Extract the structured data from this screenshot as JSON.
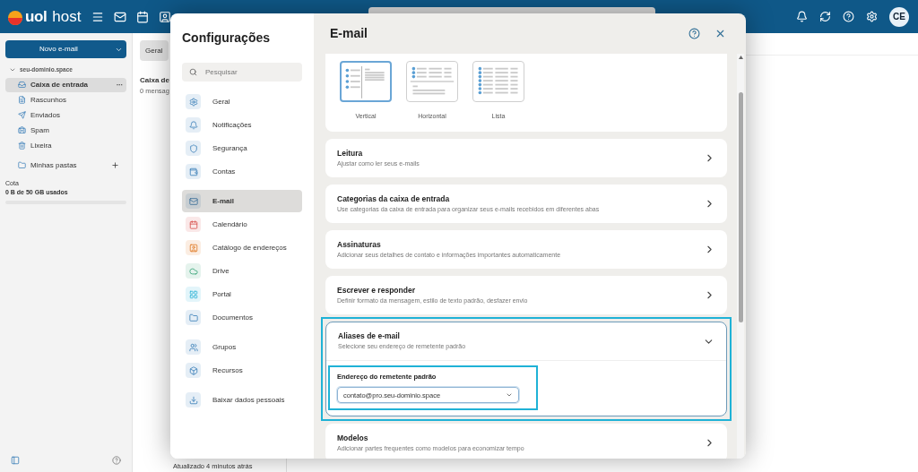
{
  "header": {
    "brand": "uol",
    "product": "host",
    "avatar": "CE"
  },
  "sidebar": {
    "new_email": "Novo e-mail",
    "account": {
      "name": "seu-dominio.space",
      "expanded": true
    },
    "folders": [
      {
        "label": "Caixa de entrada",
        "selected": true,
        "more": "···"
      },
      {
        "label": "Rascunhos",
        "selected": false
      },
      {
        "label": "Enviados",
        "selected": false
      },
      {
        "label": "Spam",
        "selected": false
      },
      {
        "label": "Lixeira",
        "selected": false
      }
    ],
    "my_folders": "Minhas pastas",
    "quota": {
      "label": "Cota",
      "usage": "0 B de 50 GB usados",
      "level": 0
    }
  },
  "message_list": {
    "filter": "Geral",
    "title": "Caixa de",
    "count": "0 mensag",
    "updated": "Atualizado 4 minutos atrás"
  },
  "settings": {
    "title": "Configurações",
    "search": {
      "placeholder": "Pesquisar"
    },
    "nav_groups": [
      {
        "items": [
          {
            "label": "Geral",
            "selected": false
          },
          {
            "label": "Notificações",
            "selected": false
          },
          {
            "label": "Segurança",
            "selected": false
          },
          {
            "label": "Contas",
            "selected": false
          }
        ]
      },
      {
        "items": [
          {
            "label": "E-mail",
            "selected": true
          },
          {
            "label": "Calendário",
            "selected": false
          },
          {
            "label": "Catálogo de endereços",
            "selected": false
          },
          {
            "label": "Drive",
            "selected": false
          },
          {
            "label": "Portal",
            "selected": false
          },
          {
            "label": "Documentos",
            "selected": false
          }
        ]
      },
      {
        "items": [
          {
            "label": "Grupos",
            "selected": false
          },
          {
            "label": "Recursos",
            "selected": false
          }
        ]
      },
      {
        "items": [
          {
            "label": "Baixar dados pessoais",
            "selected": false
          }
        ]
      }
    ],
    "panel": {
      "title": "E-mail",
      "layouts": [
        {
          "label": "Vertical",
          "selected": true
        },
        {
          "label": "Horizontal",
          "selected": false
        },
        {
          "label": "Lista",
          "selected": false
        }
      ],
      "sections": [
        {
          "title": "Leitura",
          "subtitle": "Ajustar como ler seus e-mails",
          "expanded": false,
          "highlighted": false
        },
        {
          "title": "Categorias da caixa de entrada",
          "subtitle": "Use categorias da caixa de entrada para organizar seus e-mails recebidos em diferentes abas",
          "expanded": false,
          "highlighted": false
        },
        {
          "title": "Assinaturas",
          "subtitle": "Adicionar seus detalhes de contato e informações importantes automaticamente",
          "expanded": false,
          "highlighted": false
        },
        {
          "title": "Escrever e responder",
          "subtitle": "Definir formato da mensagem, estilo de texto padrão, desfazer envio",
          "expanded": false,
          "highlighted": false
        },
        {
          "title": "Aliases de e-mail",
          "subtitle": "Selecione seu endereço de remetente padrão",
          "expanded": true,
          "highlighted": true,
          "field": {
            "label": "Endereço do remetente padrão",
            "value": "contato@pro.seu-dominio.space",
            "highlighted": true
          }
        },
        {
          "title": "Modelos",
          "subtitle": "Adicionar partes frequentes como modelos para economizar tempo",
          "expanded": false,
          "highlighted": false
        }
      ]
    }
  }
}
